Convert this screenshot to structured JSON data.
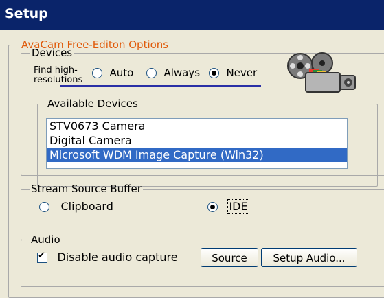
{
  "window": {
    "title": "Setup"
  },
  "options": {
    "legend": "AvaCam Free-Editon Options"
  },
  "devices": {
    "legend": "Devices",
    "find_label_line1": "Find high-",
    "find_label_line2": "resolutions",
    "radio_auto": "Auto",
    "radio_always": "Always",
    "radio_never": "Never",
    "selected": "Never",
    "icon": "video-camera-icon"
  },
  "available": {
    "legend": "Available Devices",
    "items": [
      "STV0673 Camera",
      "Digital Camera",
      "Microsoft WDM Image Capture (Win32)"
    ],
    "selected_index": 2
  },
  "stream": {
    "legend": "Stream Source Buffer",
    "radio_clipboard": "Clipboard",
    "radio_ide": "IDE",
    "selected": "IDE"
  },
  "audio": {
    "legend": "Audio",
    "disable_label": "Disable audio capture",
    "disable_checked": true,
    "source_button": "Source",
    "setup_button": "Setup Audio..."
  },
  "colors": {
    "title_bg": "#0a246a",
    "options_legend": "#e05a0a",
    "selection": "#316ac5"
  }
}
